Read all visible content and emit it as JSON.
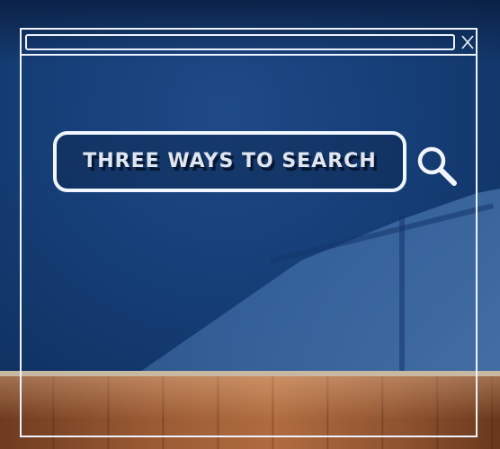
{
  "search": {
    "text": "THREE WAYS TO SEARCH",
    "icon": "search-icon"
  },
  "window": {
    "close_glyph": "X",
    "close_icon": "close-icon"
  },
  "colors": {
    "wall": "#163f78",
    "frame_line": "#eef3ff",
    "floor": "#9a5a33"
  }
}
